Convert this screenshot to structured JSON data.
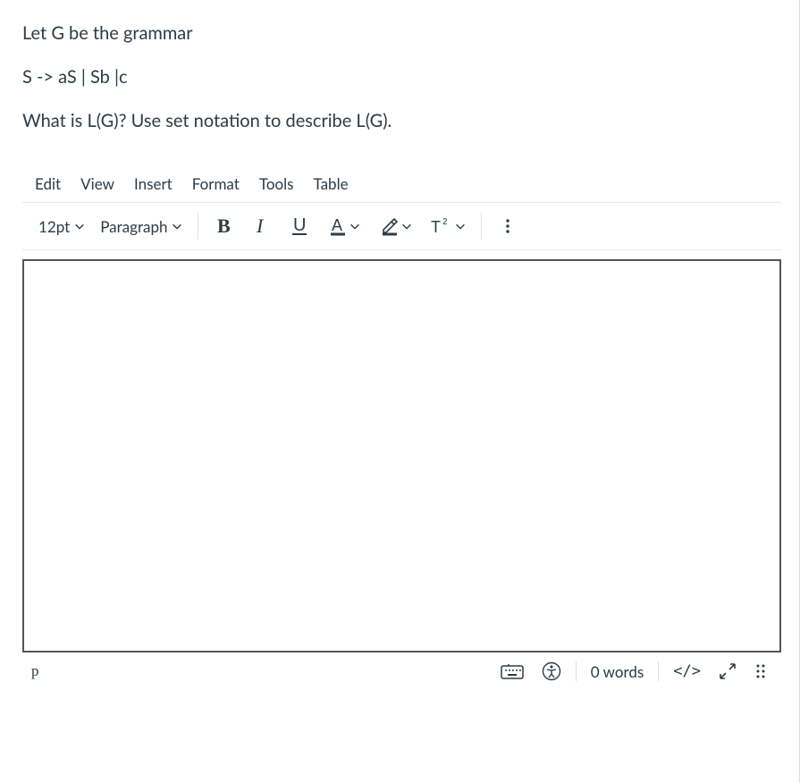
{
  "question": {
    "line1": "Let G be the grammar",
    "line2": "S -> aS  | Sb |c",
    "line3": "What is L(G)?  Use set notation to describe L(G)."
  },
  "menubar": {
    "edit": "Edit",
    "view": "View",
    "insert": "Insert",
    "format": "Format",
    "tools": "Tools",
    "table": "Table"
  },
  "toolbar": {
    "font_size": "12pt",
    "block_format": "Paragraph"
  },
  "statusbar": {
    "path": "p",
    "word_count": "0 words",
    "html_view": "</>"
  }
}
